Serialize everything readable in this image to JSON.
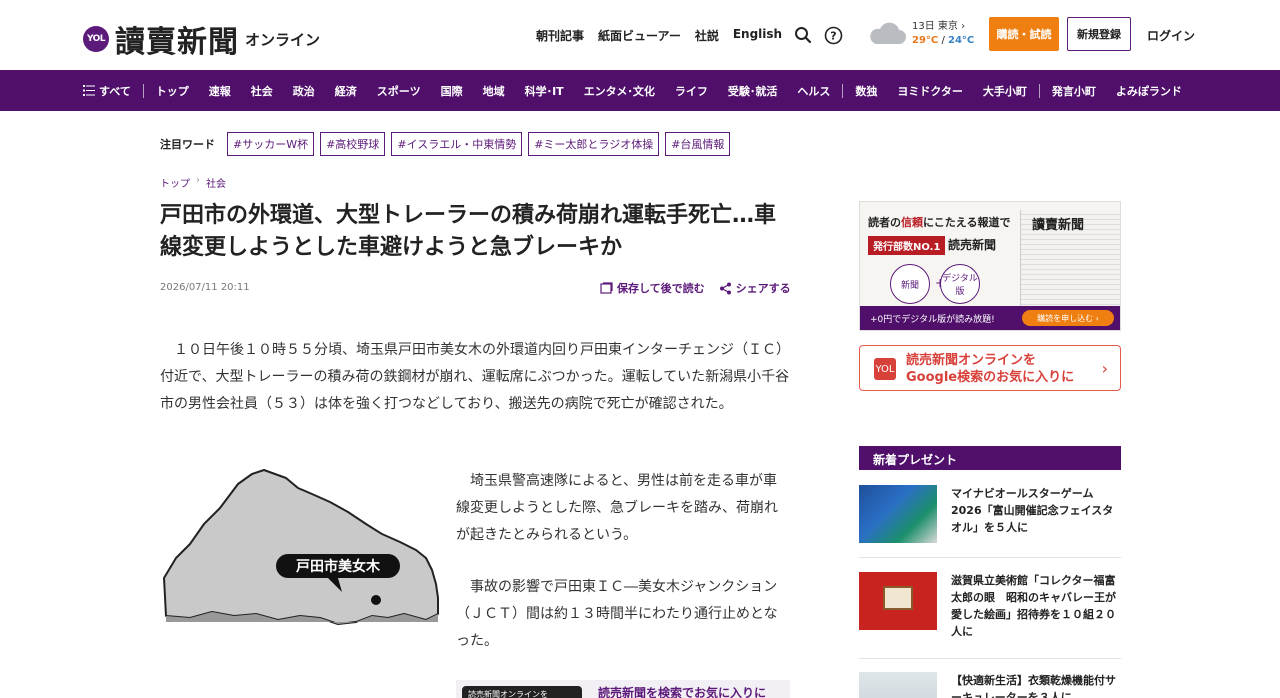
{
  "header": {
    "logo_badge": "YOL",
    "logo_main": "讀賣新聞",
    "logo_sub": "オンライン",
    "topnav": [
      "朝刊記事",
      "紙面ビューアー",
      "社説",
      "English"
    ],
    "weather": {
      "date": "13日 東京 ›",
      "high": "29°C",
      "separator": " / ",
      "low": "24°C"
    },
    "subscribe_label": "購読・試読",
    "register_label": "新規登録",
    "login_label": "ログイン"
  },
  "mainnav": {
    "all_label": "すべて",
    "group1": [
      "トップ",
      "速報",
      "社会",
      "政治",
      "経済",
      "スポーツ",
      "国際",
      "地域",
      "科学･IT",
      "エンタメ･文化",
      "ライフ",
      "受験･就活",
      "ヘルス"
    ],
    "group2": [
      "数独",
      "ヨミドクター",
      "大手小町"
    ],
    "group3": [
      "発言小町",
      "よみぽランド"
    ]
  },
  "keywords": {
    "label": "注目ワード",
    "items": [
      "#サッカーW杯",
      "#高校野球",
      "#イスラエル・中東情勢",
      "#ミー太郎とラジオ体操",
      "#台風情報"
    ]
  },
  "breadcrumb": [
    "トップ",
    "社会"
  ],
  "article": {
    "title": "戸田市の外環道、大型トレーラーの積み荷崩れ運転手死亡…車線変更しようとした車避けようと急ブレーキか",
    "date": "2026/07/11 20:11",
    "save_label": "保存して後で読む",
    "share_label": "シェアする",
    "p1": "　１０日午後１０時５５分頃、埼玉県戸田市美女木の外環道内回り戸田東インターチェンジ（ＩＣ）付近で、大型トレーラーの積み荷の鉄鋼材が崩れ、運転席にぶつかった。運転していた新潟県小千谷市の男性会社員（５３）は体を強く打つなどしており、搬送先の病院で死亡が確認された。",
    "p2": "　埼玉県警高速隊によると、男性は前を走る車が車線変更しようとした際、急ブレーキを踏み、荷崩れが起きたとみられるという。",
    "p3": "　事故の影響で戸田東ＩＣ―美女木ジャンクション（ＪＣＴ）間は約１３時間半にわたり通行止めとなった。",
    "map_label": "戸田市美女木",
    "bottom_banner_dark": "読売新聞オンラインを",
    "bottom_banner_text": "読売新聞を検索でお気に入りに"
  },
  "sidebar": {
    "ad1": {
      "headline_prefix": "読者の",
      "headline_em": "信頼",
      "headline_suffix": "にこたえる報道で",
      "badge": "発行部数NO.1",
      "name": "読売新聞",
      "circle1": "新聞",
      "plus": "+",
      "circle2": "デジタル版",
      "paper_title": "讀賣新聞",
      "foot_text": "+0円でデジタル版が読み放題!",
      "foot_button": "購読を申し込む ›"
    },
    "ad2": {
      "icon": "YOL",
      "line1": "読売新聞オンラインを",
      "line2": "Google検索のお気に入りに",
      "chevron": "›"
    },
    "presents_title": "新着プレゼント",
    "presents": [
      "マイナビオールスターゲーム2026「富山開催記念フェイスタオル」を５人に",
      "滋賀県立美術館「コレクター福富太郎の眼　昭和のキャバレー王が愛した絵画」招待券を１０組２０人に",
      "【快適新生活】衣類乾燥機能付サーキュレーターを３人に"
    ]
  },
  "colors": {
    "brand_purple": "#4f0f6b",
    "accent_orange": "#f07f12"
  }
}
